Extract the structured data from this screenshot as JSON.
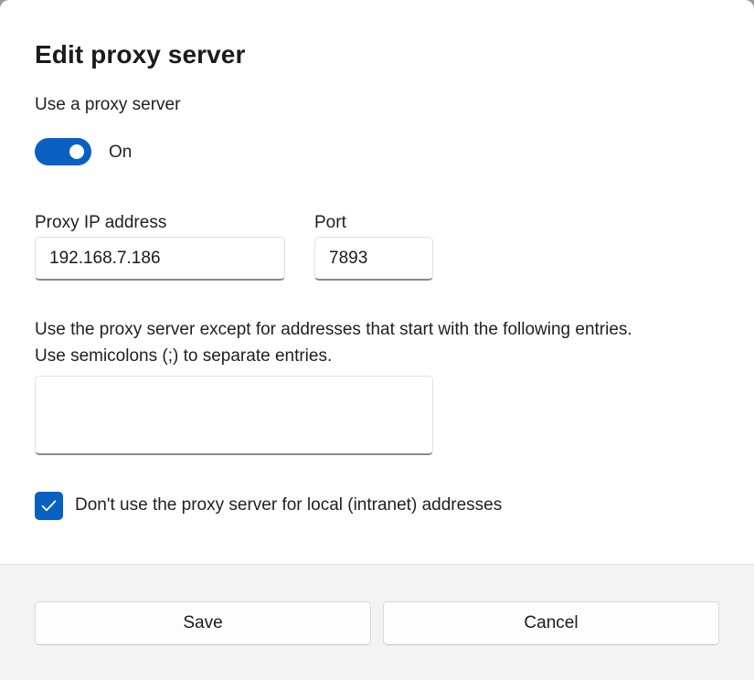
{
  "dialog": {
    "title": "Edit proxy server"
  },
  "proxy_toggle": {
    "label": "Use a proxy server",
    "state_text": "On",
    "enabled": true,
    "accent_color": "#0a5fc2"
  },
  "address": {
    "label": "Proxy IP address",
    "value": "192.168.7.186"
  },
  "port": {
    "label": "Port",
    "value": "7893"
  },
  "exceptions": {
    "hint_line1": "Use the proxy server except for addresses that start with the following entries.",
    "hint_line2": "Use semicolons (;) to separate entries.",
    "value": ""
  },
  "local_bypass": {
    "label": "Don't use the proxy server for local (intranet) addresses",
    "checked": true,
    "check_icon": "checkmark-icon"
  },
  "footer": {
    "save_label": "Save",
    "cancel_label": "Cancel"
  }
}
